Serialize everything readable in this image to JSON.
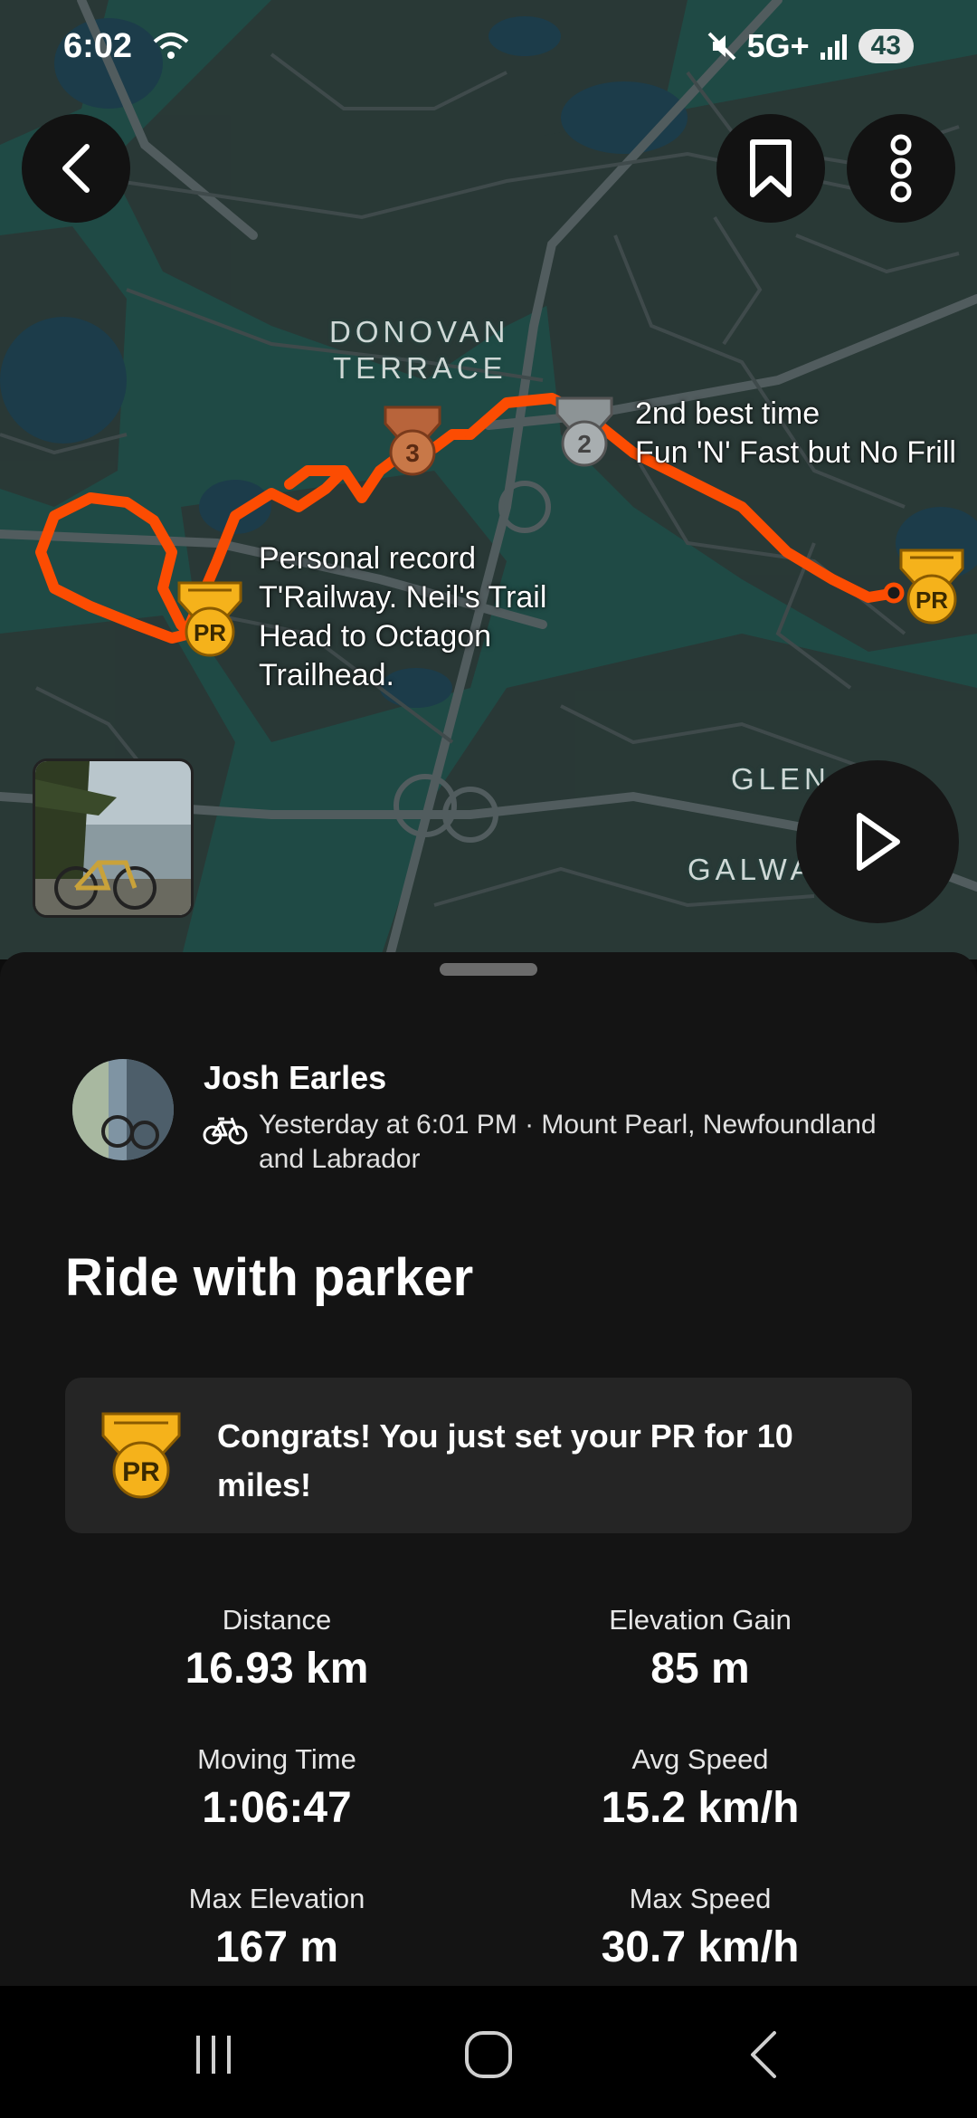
{
  "status_bar": {
    "time": "6:02",
    "network": "5G+",
    "battery": "43",
    "icons": [
      "wifi-icon",
      "mute-icon",
      "signal-icon",
      "battery-icon"
    ]
  },
  "map": {
    "labels": {
      "donovan_line1": "DONOVAN",
      "donovan_line2": "TERRACE",
      "glen": "GLEN",
      "galway": "GALWA"
    },
    "annotations": {
      "second_best": {
        "line1": "2nd best time",
        "line2": "Fun 'N' Fast but No Frill"
      },
      "personal_record": {
        "line1": "Personal record",
        "line2": "T'Railway. Neil's Trail",
        "line3": "Head to Octagon",
        "line4": "Trailhead."
      }
    },
    "medals": {
      "bronze_rank": "3",
      "silver_rank": "2",
      "pr_label": "PR"
    },
    "route_color": "#fc4c02"
  },
  "activity": {
    "athlete_name": "Josh Earles",
    "meta": "Yesterday at 6:01 PM · Mount Pearl, Newfoundland and Labrador",
    "title": "Ride with parker",
    "pr_message": "Congrats! You just set your PR for 10 miles!",
    "stats": [
      {
        "label": "Distance",
        "value": "16.93 km"
      },
      {
        "label": "Elevation Gain",
        "value": "85 m"
      },
      {
        "label": "Moving Time",
        "value": "1:06:47"
      },
      {
        "label": "Avg Speed",
        "value": "15.2 km/h"
      },
      {
        "label": "Max Elevation",
        "value": "167 m"
      },
      {
        "label": "Max Speed",
        "value": "30.7 km/h"
      }
    ]
  },
  "colors": {
    "accent": "#fc4c02",
    "pr_gold": "#f5b21b",
    "sheet_bg": "#141414",
    "card_bg": "#252525",
    "map_bg": "#1f4a45"
  }
}
